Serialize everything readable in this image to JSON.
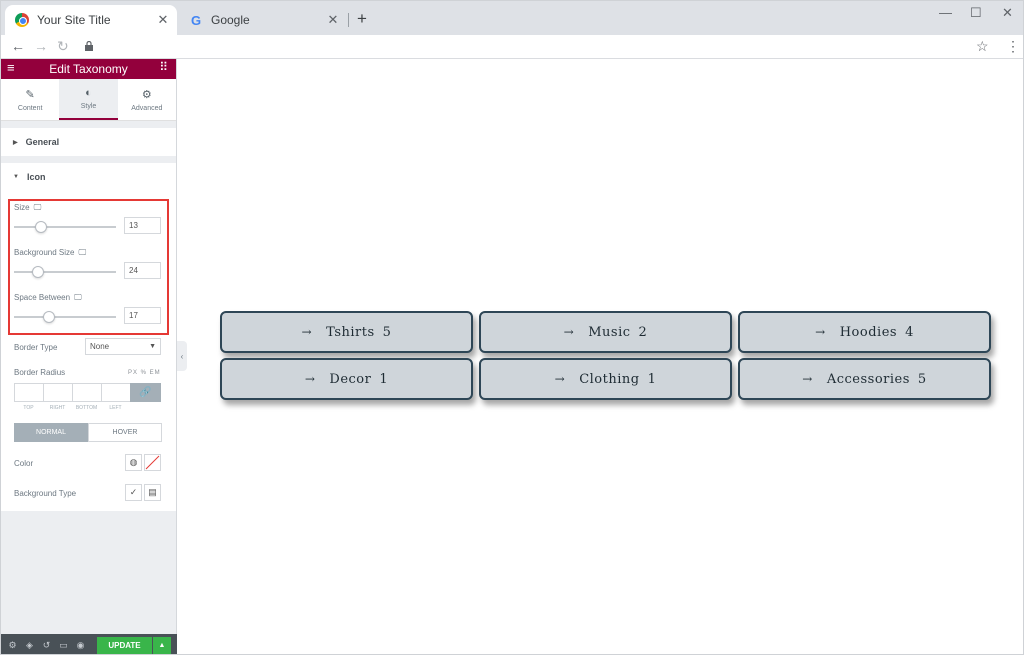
{
  "browser": {
    "tabs": [
      {
        "title": "Your Site Title",
        "favicon": "chrome-icon"
      },
      {
        "title": "Google",
        "favicon": "google-icon"
      }
    ]
  },
  "panel": {
    "title": "Edit Taxonomy",
    "tabs": [
      "Content",
      "Style",
      "Advanced"
    ],
    "active_tab": "Style",
    "sections": {
      "general": "General",
      "icon": "Icon"
    },
    "size": {
      "label": "Size",
      "value": "13",
      "level": 0.26
    },
    "background_size": {
      "label": "Background Size",
      "value": "24",
      "level": 0.24
    },
    "space_between": {
      "label": "Space Between",
      "value": "17",
      "level": 0.34
    },
    "border_type": {
      "label": "Border Type",
      "value": "None"
    },
    "border_radius": {
      "label": "Border Radius",
      "units": "PX % EM",
      "sides": [
        "TOP",
        "RIGHT",
        "BOTTOM",
        "LEFT"
      ]
    },
    "state_toggle": [
      "NORMAL",
      "HOVER"
    ],
    "color": {
      "label": "Color"
    },
    "background_type": {
      "label": "Background Type"
    },
    "update_label": "UPDATE"
  },
  "taxonomy": {
    "accent": "#2e4656",
    "fill": "#cfd5da",
    "terms": [
      {
        "name": "Tshirts",
        "count": "5"
      },
      {
        "name": "Music",
        "count": "2"
      },
      {
        "name": "Hoodies",
        "count": "4"
      },
      {
        "name": "Decor",
        "count": "1"
      },
      {
        "name": "Clothing",
        "count": "1"
      },
      {
        "name": "Accessories",
        "count": "5"
      }
    ]
  },
  "colors": {
    "brand": "#93003c",
    "update": "#39b54a",
    "highlight": "#e53935"
  }
}
